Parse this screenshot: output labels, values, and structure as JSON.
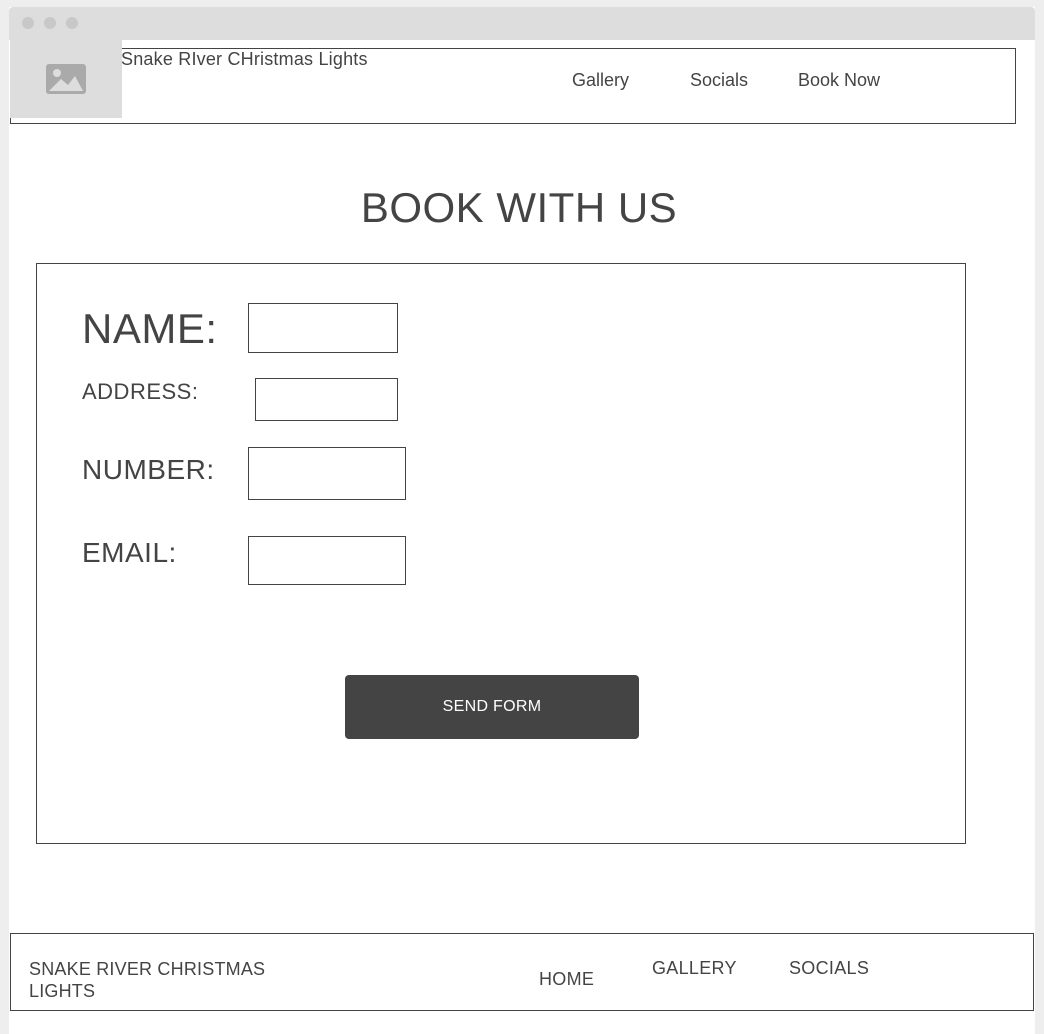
{
  "header": {
    "title": "Snake RIver CHristmas Lights",
    "logo_icon": "image-placeholder-icon",
    "nav": [
      "Gallery",
      "Socials",
      "Book Now"
    ]
  },
  "page": {
    "heading": "BOOK WITH US"
  },
  "form": {
    "name_label": "NAME:",
    "address_label": "ADDRESS:",
    "number_label": "NUMBER:",
    "email_label": "EMAIL:",
    "submit_label": "SEND FORM"
  },
  "footer": {
    "title": "SNAKE RIVER CHRISTMAS LIGHTS",
    "links": [
      "HOME",
      "GALLERY",
      "SOCIALS"
    ]
  },
  "colors": {
    "text": "#444444",
    "button": "#444444",
    "placeholder": "#dddddd"
  }
}
